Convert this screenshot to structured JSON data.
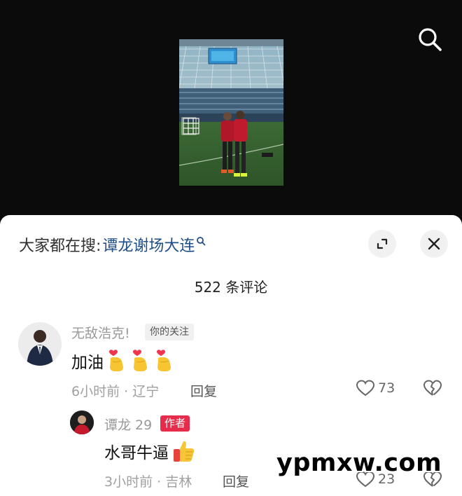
{
  "video": {
    "search_icon": "search-icon",
    "frame_description_icon": "stadium-photo"
  },
  "sheet": {
    "hot_search_label": "大家都在搜:",
    "hot_search_term": "谭龙谢场大连",
    "comment_count": "522 条评论",
    "expand_icon": "expand-icon",
    "close_icon": "close-icon"
  },
  "comments": [
    {
      "username": "无敌浩克!",
      "tag": "你的关注",
      "text": "加油",
      "emojis": [
        "finger-heart-emoji",
        "finger-heart-emoji",
        "finger-heart-emoji"
      ],
      "meta": "6小时前 · 辽宁",
      "reply_label": "回复",
      "likes": "73"
    },
    {
      "username": "谭龙 29",
      "tag": "作者",
      "text": "水哥牛逼",
      "emojis": [
        "thumbs-up-emoji"
      ],
      "meta": "3小时前 · 吉林",
      "reply_label": "回复",
      "likes": "23"
    }
  ],
  "watermark": "ypmxw.com",
  "colors": {
    "accent_link": "#1f4f86",
    "author_tag": "#e62c4a",
    "background_dark": "#0b0b0b"
  }
}
